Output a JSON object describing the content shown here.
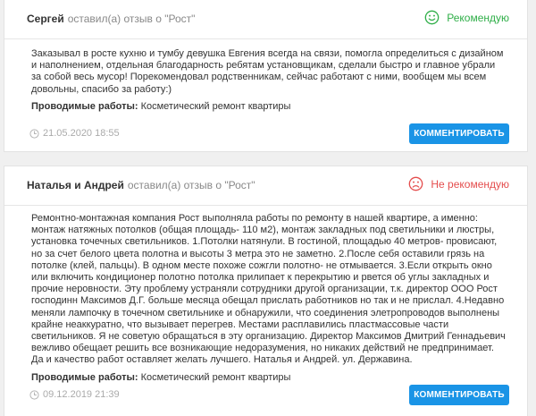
{
  "reviews": [
    {
      "author": "Сергей",
      "meta": "оставил(а) отзыв о \"Рост\"",
      "verdict": "Рекомендую",
      "text": "Заказывал в росте кухню и тумбу девушка Евгения всегда на связи, помогла определиться с дизайном и наполнением, отдельная благодарность ребятам установщикам, сделали быстро и главное убрали за собой весь мусор! Порекомендовал родственникам, сейчас работают с ними, вообщем мы всем довольны, спасибо за работу:)",
      "works_label": "Проводимые работы:",
      "works_value": "Косметический ремонт квартиры",
      "date": "21.05.2020 18:55",
      "button": "КОММЕНТИРОВАТЬ"
    },
    {
      "author": "Наталья и Андрей",
      "meta": "оставил(а) отзыв о \"Рост\"",
      "verdict": "Не рекомендую",
      "text": "Ремонтно-монтажная компания Рост выполняла работы по ремонту в нашей квартире, а именно: монтаж натяжных потолков (общая площадь- 110 м2), монтаж закладных под светильники и люстры, установка точечных светильников. 1.Потолки натянули. В гостиной, площадью 40 метров- провисают, но за счет белого цвета полотна и высоты 3 метра это не заметно. 2.После себя оставили грязь на потолке (клей, пальцы). В одном месте похоже сожгли полотно- не отмывается. 3.Если открыть окно или включить кондиционер полотно потолка прилипает к перекрытию и рвется об углы закладных и прочие неровности. Эту проблему устраняли сотрудники другой организации, т.к. директор ООО Рост господинн Максимов Д.Г. больше месяца обещал прислать работников но так и не прислал. 4.Недавно меняли лампочку в точечном светильнике и обнаружили, что соединения элетропроводов выполнены крайне неаккуратно, что вызывает перегрев. Местами расплавились пластмассовые части светильников. Я не советую обращаться в эту организацию. Директор Максимов Дмитрий Геннадьевич вежливо обещает решить все возникающие недоразумения, но никаких действий не предпринимает. Да и качество работ оставляет желать лучшего. Наталья и Андрей. ул. Державина.",
      "works_label": "Проводимые работы:",
      "works_value": "Косметический ремонт квартиры",
      "date": "09.12.2019 21:39",
      "button": "КОММЕНТИРОВАТЬ"
    }
  ],
  "icons": {
    "positive": "smile-icon",
    "negative": "frown-icon",
    "date": "clock-icon"
  },
  "colors": {
    "positive": "#2fae48",
    "negative": "#e44d4d",
    "button": "#1a94e6"
  }
}
